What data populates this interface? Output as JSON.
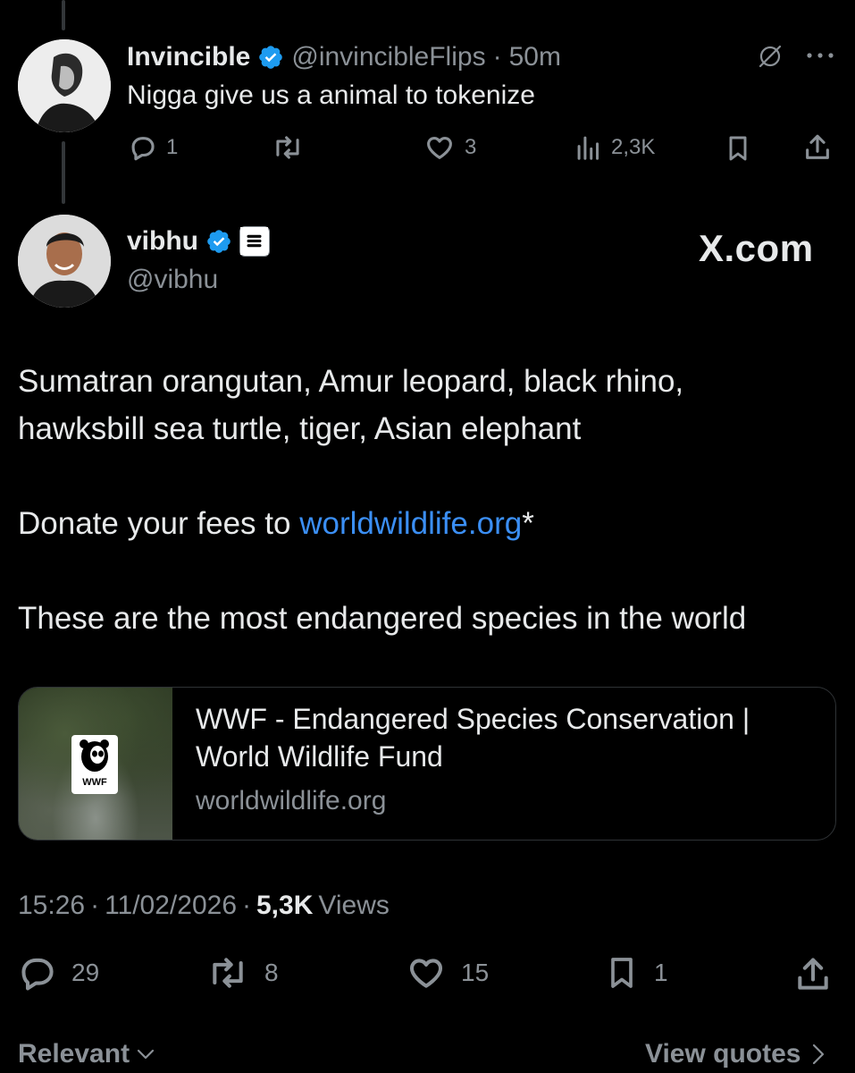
{
  "reply": {
    "name": "Invincible",
    "handle": "@invincibleFlips",
    "separator": "·",
    "time": "50m",
    "text": "Nigga give us a animal to tokenize",
    "metrics": {
      "replies": "1",
      "reposts": "",
      "likes": "3",
      "views": "2,3K"
    }
  },
  "post": {
    "name": "vibhu",
    "handle": "@vibhu",
    "watermark": "X.com",
    "line1": "Sumatran orangutan, Amur leopard, black rhino,",
    "line2": "hawksbill sea turtle, tiger, Asian elephant",
    "donate_prefix": "Donate your fees to ",
    "donate_link": "worldwildlife.org",
    "donate_suffix": "*",
    "line4": "These are the most endangered species in the world",
    "card": {
      "title_line1": "WWF - Endangered Species Conservation |",
      "title_line2": "World Wildlife Fund",
      "domain": "worldwildlife.org",
      "logo_text": "WWF"
    },
    "time": "15:26",
    "date": "11/02/2026",
    "sep": "·",
    "views_count": "5,3K",
    "views_label": "Views",
    "metrics": {
      "replies": "29",
      "reposts": "8",
      "likes": "15",
      "bookmarks": "1"
    }
  },
  "footer": {
    "sort_label": "Relevant",
    "quotes_label": "View quotes"
  },
  "colors": {
    "background": "#000000",
    "text": "#e7e9ea",
    "muted": "#8b9197",
    "link": "#3b8ff5",
    "verified": "#1d9bf0"
  }
}
